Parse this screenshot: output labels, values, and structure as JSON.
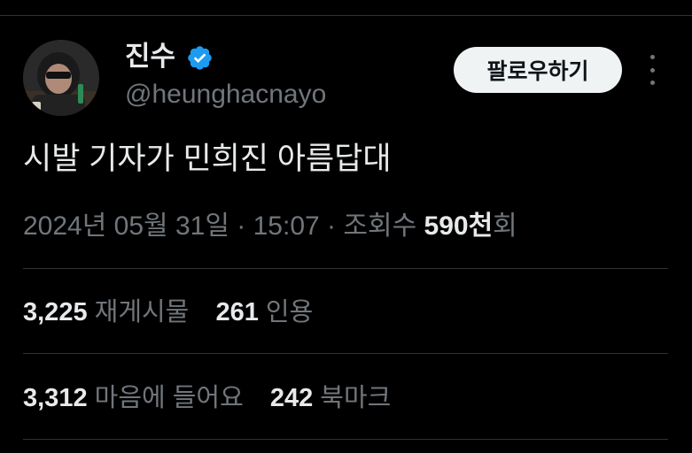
{
  "user": {
    "display_name": "진수",
    "handle": "@heunghacnayo",
    "verified": true,
    "verified_color": "#1d9bf0"
  },
  "follow_button": {
    "label": "팔로우하기"
  },
  "more_menu": {
    "icon": "more-vertical-icon"
  },
  "tweet": {
    "text": "시발 기자가 민희진 아름답대"
  },
  "meta": {
    "date": "2024년 05월 31일",
    "sep1": " · ",
    "time": "15:07",
    "sep2": " · ",
    "views_label": "조회수 ",
    "views_count": "590천",
    "views_suffix": "회"
  },
  "stats": {
    "reposts_count": "3,225",
    "reposts_label": "재게시물",
    "quotes_count": "261",
    "quotes_label": "인용",
    "likes_count": "3,312",
    "likes_label": "마음에 들어요",
    "bookmarks_count": "242",
    "bookmarks_label": "북마크"
  }
}
